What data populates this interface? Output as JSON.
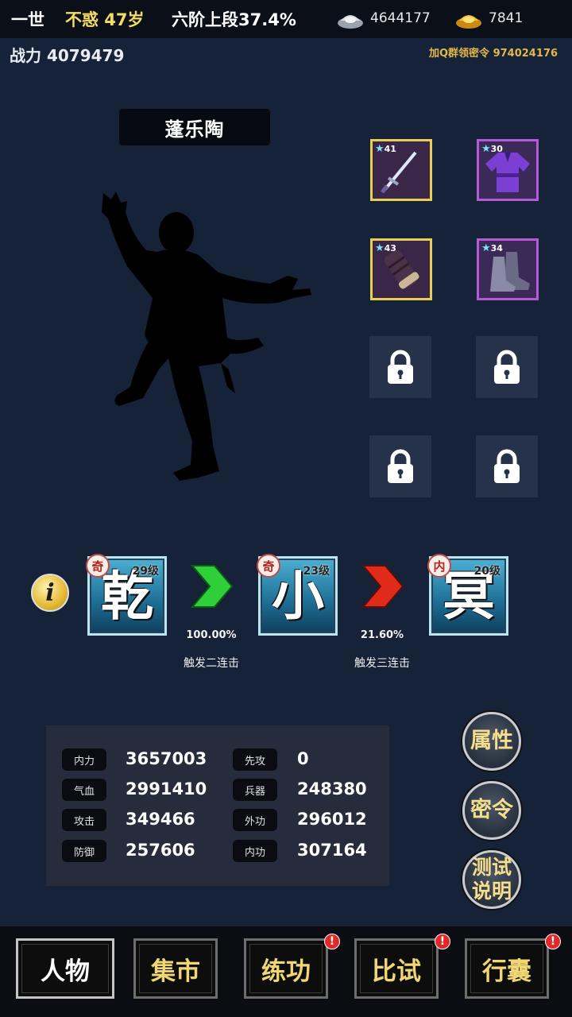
{
  "top": {
    "life": "一世",
    "age_title": "不惑 47岁",
    "rank": "六阶上段37.4%",
    "silver": "4644177",
    "gold": "7841"
  },
  "power": "战力 4079479",
  "promo": "加Q群领密令 974024176",
  "character_name": "蓬乐陶",
  "equipment": [
    {
      "level": "41",
      "icon": "sword-icon",
      "rarity_color": "#e7cf56"
    },
    {
      "level": "30",
      "icon": "robe-icon",
      "rarity_color": "#b35ad9"
    },
    {
      "level": "43",
      "icon": "bracer-icon",
      "rarity_color": "#e7cf56"
    },
    {
      "level": "34",
      "icon": "boots-icon",
      "rarity_color": "#b35ad9"
    }
  ],
  "locked_slots": [
    "lock-icon",
    "lock-icon",
    "lock-icon",
    "lock-icon"
  ],
  "info_label": "i",
  "skills": [
    {
      "glyph": "乾",
      "level": "29级",
      "tag": "奇"
    },
    {
      "glyph": "小",
      "level": "23级",
      "tag": "奇"
    },
    {
      "glyph": "冥",
      "level": "20级",
      "tag": "内"
    }
  ],
  "chain": [
    {
      "percent": "100.00%",
      "trigger": "触发二连击",
      "color": "#2fcf3a"
    },
    {
      "percent": "21.60%",
      "trigger": "触发三连击",
      "color": "#e02a1a"
    }
  ],
  "stats": [
    {
      "label": "内力",
      "value": "3657003"
    },
    {
      "label": "先攻",
      "value": "0"
    },
    {
      "label": "气血",
      "value": "2991410"
    },
    {
      "label": "兵器",
      "value": "248380"
    },
    {
      "label": "攻击",
      "value": "349466"
    },
    {
      "label": "外功",
      "value": "296012"
    },
    {
      "label": "防御",
      "value": "257606"
    },
    {
      "label": "内功",
      "value": "307164"
    }
  ],
  "side_buttons": {
    "attributes": "属性",
    "code": "密令",
    "test_line1": "测试",
    "test_line2": "说明"
  },
  "nav": [
    {
      "label": "人物",
      "badge": ""
    },
    {
      "label": "集市",
      "badge": ""
    },
    {
      "label": "练功",
      "badge": "!"
    },
    {
      "label": "比试",
      "badge": "!"
    },
    {
      "label": "行囊",
      "badge": "!"
    }
  ]
}
